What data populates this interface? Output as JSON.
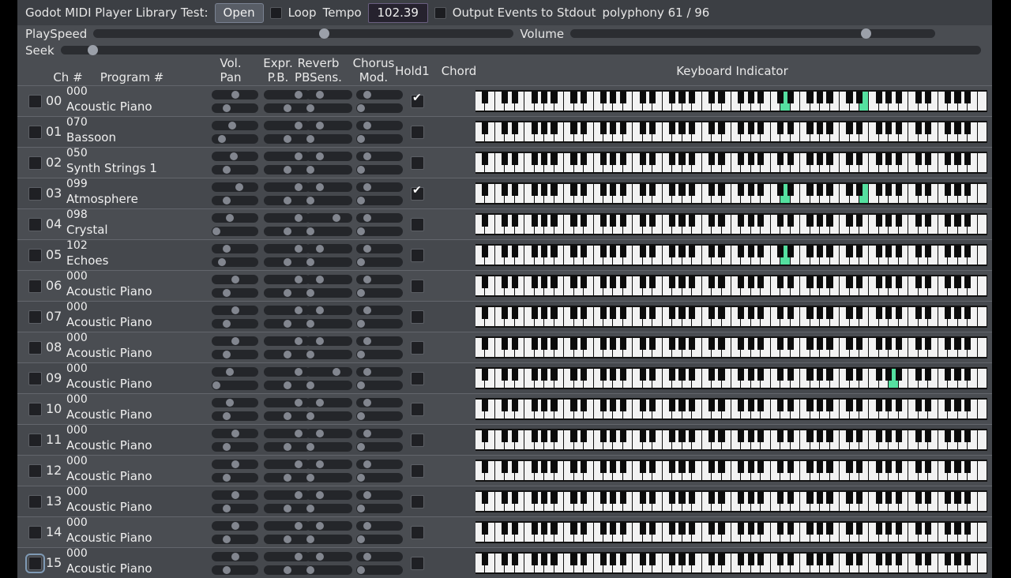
{
  "window": {
    "title": "Godot MIDI Player Library Test:"
  },
  "toolbar": {
    "title": "Godot MIDI Player Library Test:",
    "open_label": "Open",
    "loop_label": "Loop",
    "loop_checked": false,
    "tempo_label": "Tempo",
    "tempo_value": "102.39",
    "stdout_label": "Output Events to Stdout",
    "stdout_checked": false,
    "polyphony_label": "polyphony 61 / 96"
  },
  "sliders": {
    "playspeed": {
      "label": "PlaySpeed",
      "percent": 55
    },
    "volume": {
      "label": "Volume",
      "percent": 82
    },
    "seek": {
      "label": "Seek",
      "percent": 3
    }
  },
  "columns": {
    "ch": "Ch #",
    "program": "Program #",
    "vol": "Vol.",
    "pan": "Pan",
    "expr": "Expr.",
    "pb": "P.B.",
    "reverb": "Reverb",
    "pbsens": "PBSens.",
    "chorus": "Chorus",
    "mod": "Mod.",
    "hold1": "Hold1",
    "chord": "Chord",
    "keyboard": "Keyboard Indicator"
  },
  "colors": {
    "app_bg": "#4a4d52",
    "topbar_bg": "#3c3f44",
    "accent_key_on": "#55e0a0",
    "black_key_on": "#9fc6ef",
    "track": "#2b2d31",
    "knob": "#9ba0a9"
  },
  "keyboard": {
    "white_keys": 52,
    "highlight_green_white": [
      31,
      39
    ],
    "highlight_blue_black": [
      32
    ]
  },
  "channels": [
    {
      "num": "00",
      "program_num": "000",
      "program_name": "Acoustic Piano",
      "hold1": true,
      "focus": false,
      "vol": 50,
      "pan": 28,
      "expr": 80,
      "pb": 50,
      "reverb": 27,
      "pbsens": 3,
      "chorus": 18,
      "mod": 3,
      "green_keys": [
        31,
        39
      ],
      "blue_black_keys": [
        32
      ]
    },
    {
      "num": "01",
      "program_num": "070",
      "program_name": "Bassoon",
      "hold1": false,
      "focus": false,
      "vol": 43,
      "pan": 16,
      "expr": 80,
      "pb": 50,
      "reverb": 27,
      "pbsens": 3,
      "chorus": 18,
      "mod": 3,
      "green_keys": [],
      "blue_black_keys": []
    },
    {
      "num": "02",
      "program_num": "050",
      "program_name": "Synth Strings 1",
      "hold1": false,
      "focus": false,
      "vol": 46,
      "pan": 28,
      "expr": 80,
      "pb": 50,
      "reverb": 27,
      "pbsens": 3,
      "chorus": 18,
      "mod": 3,
      "green_keys": [],
      "blue_black_keys": []
    },
    {
      "num": "03",
      "program_num": "099",
      "program_name": "Atmosphere",
      "hold1": true,
      "focus": false,
      "vol": 62,
      "pan": 28,
      "expr": 80,
      "pb": 50,
      "reverb": 27,
      "pbsens": 3,
      "chorus": 18,
      "mod": 3,
      "green_keys": [
        31,
        39
      ],
      "blue_black_keys": [
        32
      ]
    },
    {
      "num": "04",
      "program_num": "098",
      "program_name": "Crystal",
      "hold1": false,
      "focus": false,
      "vol": 36,
      "pan": 3,
      "expr": 80,
      "pb": 50,
      "reverb": 70,
      "pbsens": 3,
      "chorus": 18,
      "mod": 3,
      "green_keys": [],
      "blue_black_keys": []
    },
    {
      "num": "05",
      "program_num": "102",
      "program_name": "Echoes",
      "hold1": false,
      "focus": false,
      "vol": 28,
      "pan": 16,
      "expr": 80,
      "pb": 50,
      "reverb": 27,
      "pbsens": 3,
      "chorus": 18,
      "mod": 3,
      "green_keys": [
        31
      ],
      "blue_black_keys": []
    },
    {
      "num": "06",
      "program_num": "000",
      "program_name": "Acoustic Piano",
      "hold1": false,
      "focus": false,
      "vol": 50,
      "pan": 28,
      "expr": 80,
      "pb": 50,
      "reverb": 27,
      "pbsens": 3,
      "chorus": 18,
      "mod": 3,
      "green_keys": [],
      "blue_black_keys": []
    },
    {
      "num": "07",
      "program_num": "000",
      "program_name": "Acoustic Piano",
      "hold1": false,
      "focus": false,
      "vol": 50,
      "pan": 28,
      "expr": 80,
      "pb": 50,
      "reverb": 27,
      "pbsens": 3,
      "chorus": 18,
      "mod": 3,
      "green_keys": [],
      "blue_black_keys": []
    },
    {
      "num": "08",
      "program_num": "000",
      "program_name": "Acoustic Piano",
      "hold1": false,
      "focus": false,
      "vol": 50,
      "pan": 28,
      "expr": 80,
      "pb": 50,
      "reverb": 27,
      "pbsens": 3,
      "chorus": 18,
      "mod": 3,
      "green_keys": [],
      "blue_black_keys": []
    },
    {
      "num": "09",
      "program_num": "000",
      "program_name": "Acoustic Piano",
      "hold1": false,
      "focus": false,
      "vol": 36,
      "pan": 3,
      "expr": 80,
      "pb": 50,
      "reverb": 70,
      "pbsens": 3,
      "chorus": 18,
      "mod": 3,
      "green_keys": [
        42
      ],
      "blue_black_keys": []
    },
    {
      "num": "10",
      "program_num": "000",
      "program_name": "Acoustic Piano",
      "hold1": false,
      "focus": false,
      "vol": 36,
      "pan": 28,
      "expr": 80,
      "pb": 50,
      "reverb": 27,
      "pbsens": 3,
      "chorus": 18,
      "mod": 3,
      "green_keys": [],
      "blue_black_keys": []
    },
    {
      "num": "11",
      "program_num": "000",
      "program_name": "Acoustic Piano",
      "hold1": false,
      "focus": false,
      "vol": 50,
      "pan": 28,
      "expr": 80,
      "pb": 50,
      "reverb": 27,
      "pbsens": 3,
      "chorus": 18,
      "mod": 3,
      "green_keys": [],
      "blue_black_keys": []
    },
    {
      "num": "12",
      "program_num": "000",
      "program_name": "Acoustic Piano",
      "hold1": false,
      "focus": false,
      "vol": 50,
      "pan": 28,
      "expr": 80,
      "pb": 50,
      "reverb": 27,
      "pbsens": 3,
      "chorus": 18,
      "mod": 3,
      "green_keys": [],
      "blue_black_keys": []
    },
    {
      "num": "13",
      "program_num": "000",
      "program_name": "Acoustic Piano",
      "hold1": false,
      "focus": false,
      "vol": 50,
      "pan": 28,
      "expr": 80,
      "pb": 50,
      "reverb": 27,
      "pbsens": 3,
      "chorus": 18,
      "mod": 3,
      "green_keys": [],
      "blue_black_keys": []
    },
    {
      "num": "14",
      "program_num": "000",
      "program_name": "Acoustic Piano",
      "hold1": false,
      "focus": false,
      "vol": 50,
      "pan": 28,
      "expr": 80,
      "pb": 50,
      "reverb": 27,
      "pbsens": 3,
      "chorus": 18,
      "mod": 3,
      "green_keys": [],
      "blue_black_keys": []
    },
    {
      "num": "15",
      "program_num": "000",
      "program_name": "Acoustic Piano",
      "hold1": false,
      "focus": true,
      "vol": 50,
      "pan": 28,
      "expr": 80,
      "pb": 50,
      "reverb": 27,
      "pbsens": 3,
      "chorus": 18,
      "mod": 3,
      "green_keys": [],
      "blue_black_keys": []
    }
  ]
}
